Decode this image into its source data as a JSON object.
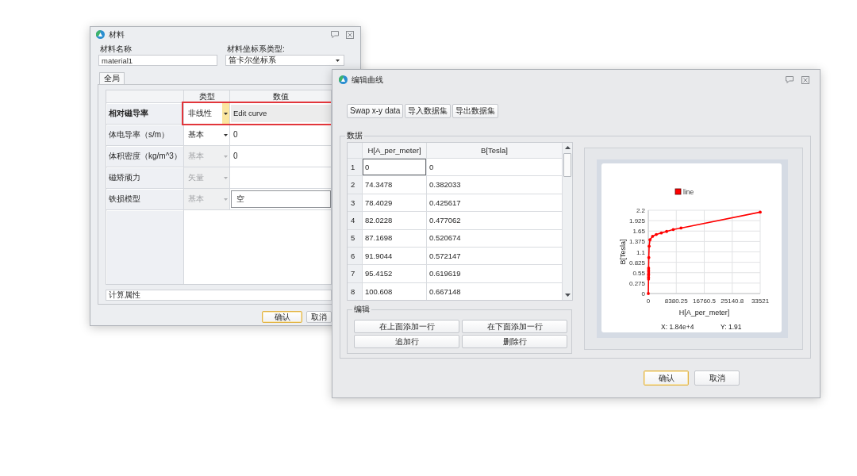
{
  "material_dialog": {
    "title": "材料",
    "name_field": {
      "label": "材料名称",
      "value": "material1"
    },
    "coordinate_field": {
      "label": "材料坐标系类型:",
      "value": "笛卡尔坐标系"
    },
    "tabs": [
      {
        "label": "全局",
        "selected": true
      }
    ],
    "table": {
      "columns": [
        "类型",
        "数值"
      ],
      "rows": [
        {
          "label": "相对磁导率",
          "selected": true,
          "highlighted": true,
          "type": {
            "text": "非线性",
            "disabled": false
          },
          "value": {
            "kind": "editor",
            "text": "Edit curve"
          }
        },
        {
          "label": "体电导率（s/m）",
          "selected": false,
          "highlighted": false,
          "type": {
            "text": "基本",
            "disabled": false
          },
          "value": {
            "kind": "text",
            "text": "0"
          }
        },
        {
          "label": "体积密度（kg/m^3）",
          "selected": false,
          "highlighted": false,
          "type": {
            "text": "基本",
            "disabled": true
          },
          "value": {
            "kind": "text",
            "text": "0"
          }
        },
        {
          "label": "磁矫顽力",
          "selected": false,
          "highlighted": false,
          "type": {
            "text": "矢量",
            "disabled": true
          },
          "value": {
            "kind": "text"
          }
        },
        {
          "label": "铁损模型",
          "selected": false,
          "highlighted": false,
          "type": {
            "text": "基本",
            "disabled": true
          },
          "value": {
            "kind": "field",
            "text": "空"
          }
        }
      ]
    },
    "description": "计算属性",
    "buttons": [
      {
        "label": "确认",
        "default": true
      },
      {
        "label": "取消",
        "default": false
      }
    ]
  },
  "curve_dialog": {
    "title": "编辑曲线",
    "toolbar": [
      "Swap x-y data",
      "导入数据集",
      "导出数据集"
    ],
    "data_group": {
      "title": "数据",
      "table": {
        "columns": [
          "H[A_per_meter]",
          "B[Tesla]"
        ],
        "rows": [
          {
            "index": "1",
            "h": "0",
            "b": "0",
            "selected": true
          },
          {
            "index": "2",
            "h": "74.3478",
            "b": "0.382033",
            "selected": false
          },
          {
            "index": "3",
            "h": "78.4029",
            "b": "0.425617",
            "selected": false
          },
          {
            "index": "4",
            "h": "82.0228",
            "b": "0.477062",
            "selected": false
          },
          {
            "index": "5",
            "h": "87.1698",
            "b": "0.520674",
            "selected": false
          },
          {
            "index": "6",
            "h": "91.9044",
            "b": "0.572147",
            "selected": false
          },
          {
            "index": "7",
            "h": "95.4152",
            "b": "0.619619",
            "selected": false
          },
          {
            "index": "8",
            "h": "100.608",
            "b": "0.667148",
            "selected": false
          }
        ]
      },
      "edit_group": {
        "title": "编辑",
        "buttons": [
          "在上面添加一行",
          "在下面添加一行",
          "追加行",
          "删除行"
        ]
      },
      "chart": {
        "chart_data": {
          "type": "line",
          "grid": true,
          "xlabel": "H[A_per_meter]",
          "ylabel": "B[Tesla]",
          "xlim": [
            0,
            33521
          ],
          "ylim": [
            0,
            2.2
          ],
          "xticks": [
            0,
            8380.25,
            16760.5,
            25140.8,
            33521
          ],
          "yticks": [
            0,
            0.275,
            0.55,
            0.825,
            1.1,
            1.375,
            1.65,
            1.925,
            2.2
          ],
          "x": [
            0,
            74,
            78,
            82,
            87,
            92,
            95,
            101,
            150,
            250,
            500,
            1270,
            2390,
            3900,
            5490,
            7480,
            9790,
            33521
          ],
          "series": [
            {
              "name": "line",
              "color": "#ff0000",
              "values": [
                0,
                0.38,
                0.43,
                0.48,
                0.52,
                0.57,
                0.62,
                0.67,
                0.95,
                1.25,
                1.42,
                1.51,
                1.56,
                1.6,
                1.64,
                1.69,
                1.73,
                2.15
              ]
            }
          ]
        },
        "readouts": [
          "X: 1.84e+4",
          "Y: 1.91"
        ]
      }
    },
    "buttons": [
      {
        "label": "确认",
        "default": true
      },
      {
        "label": "取消",
        "default": false
      }
    ]
  }
}
